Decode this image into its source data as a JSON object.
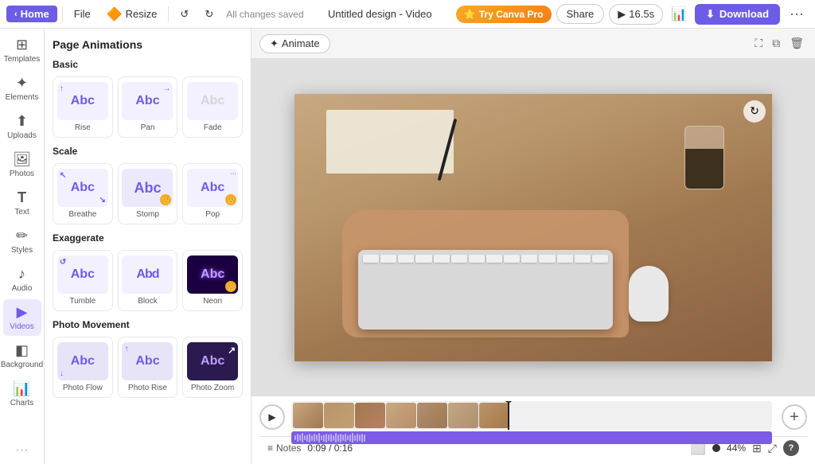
{
  "topbar": {
    "home_label": "Home",
    "file_label": "File",
    "resize_label": "Resize",
    "saved_text": "All changes saved",
    "title": "Untitled design - Video",
    "try_pro_label": "Try Canva Pro",
    "share_label": "Share",
    "preview_duration": "16.5s",
    "download_label": "Download"
  },
  "sidebar": {
    "items": [
      {
        "label": "Templates",
        "icon": "⊞"
      },
      {
        "label": "Elements",
        "icon": "✦"
      },
      {
        "label": "Uploads",
        "icon": "⬆"
      },
      {
        "label": "Photos",
        "icon": "🖼"
      },
      {
        "label": "Text",
        "icon": "T"
      },
      {
        "label": "Styles",
        "icon": "✏"
      },
      {
        "label": "Audio",
        "icon": "♪"
      },
      {
        "label": "Videos",
        "icon": "▶"
      },
      {
        "label": "Background",
        "icon": "◧"
      },
      {
        "label": "Charts",
        "icon": "📊"
      }
    ]
  },
  "panel": {
    "title": "Page Animations",
    "sections": [
      {
        "label": "Basic",
        "animations": [
          {
            "name": "Rise",
            "style": "rise",
            "crown": false
          },
          {
            "name": "Pan",
            "style": "pan",
            "crown": false
          },
          {
            "name": "Fade",
            "style": "fade",
            "crown": false
          }
        ]
      },
      {
        "label": "Scale",
        "animations": [
          {
            "name": "Breathe",
            "style": "breathe",
            "crown": false
          },
          {
            "name": "Stomp",
            "style": "stomp",
            "crown": true
          },
          {
            "name": "Pop",
            "style": "pop",
            "crown": true
          }
        ]
      },
      {
        "label": "Exaggerate",
        "animations": [
          {
            "name": "Tumble",
            "style": "tumble",
            "crown": false
          },
          {
            "name": "Block",
            "style": "block",
            "crown": false
          },
          {
            "name": "Neon",
            "style": "neon",
            "crown": true
          }
        ]
      },
      {
        "label": "Photo Movement",
        "animations": [
          {
            "name": "Photo Flow",
            "style": "photo-flow",
            "crown": false
          },
          {
            "name": "Photo Rise",
            "style": "photo-rise",
            "crown": false
          },
          {
            "name": "Photo Zoom",
            "style": "photo-zoom",
            "crown": false
          }
        ]
      }
    ]
  },
  "canvas": {
    "animate_label": "Animate"
  },
  "timeline": {
    "time_current": "0:09",
    "time_total": "0:16"
  },
  "bottombar": {
    "notes_label": "Notes",
    "time_label": "0:09 / 0:16",
    "zoom_label": "44%"
  }
}
